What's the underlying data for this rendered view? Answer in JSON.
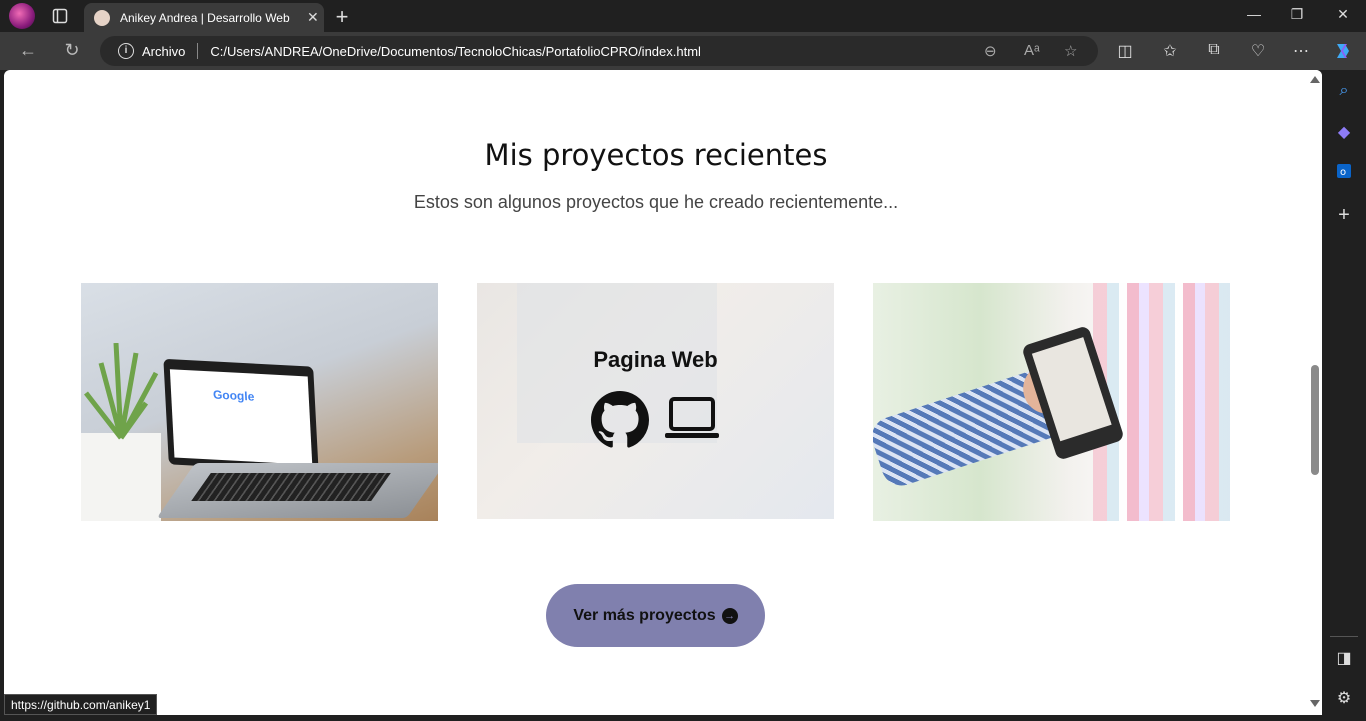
{
  "browser": {
    "tab_title": "Anikey Andrea | Desarrollo Web",
    "tab_close": "✕",
    "new_tab": "+",
    "site_info": "Archivo",
    "url": "C:/Users/ANDREA/OneDrive/Documentos/TecnoloChicas/PortafolioCPRO/index.html",
    "status_url": "https://github.com/anikey1",
    "window": {
      "minimize": "—",
      "restore": "❐",
      "close": "✕"
    }
  },
  "page": {
    "heading": "Mis proyectos recientes",
    "subheading": "Estos son algunos proyectos que he creado recientemente...",
    "card2_title": "Pagina Web",
    "more_button": "Ver más proyectos",
    "more_button_icon": "→"
  },
  "colors": {
    "button_bg": "#8080ae",
    "chrome_bg": "#202020",
    "toolbar_bg": "#3b3b3b"
  }
}
